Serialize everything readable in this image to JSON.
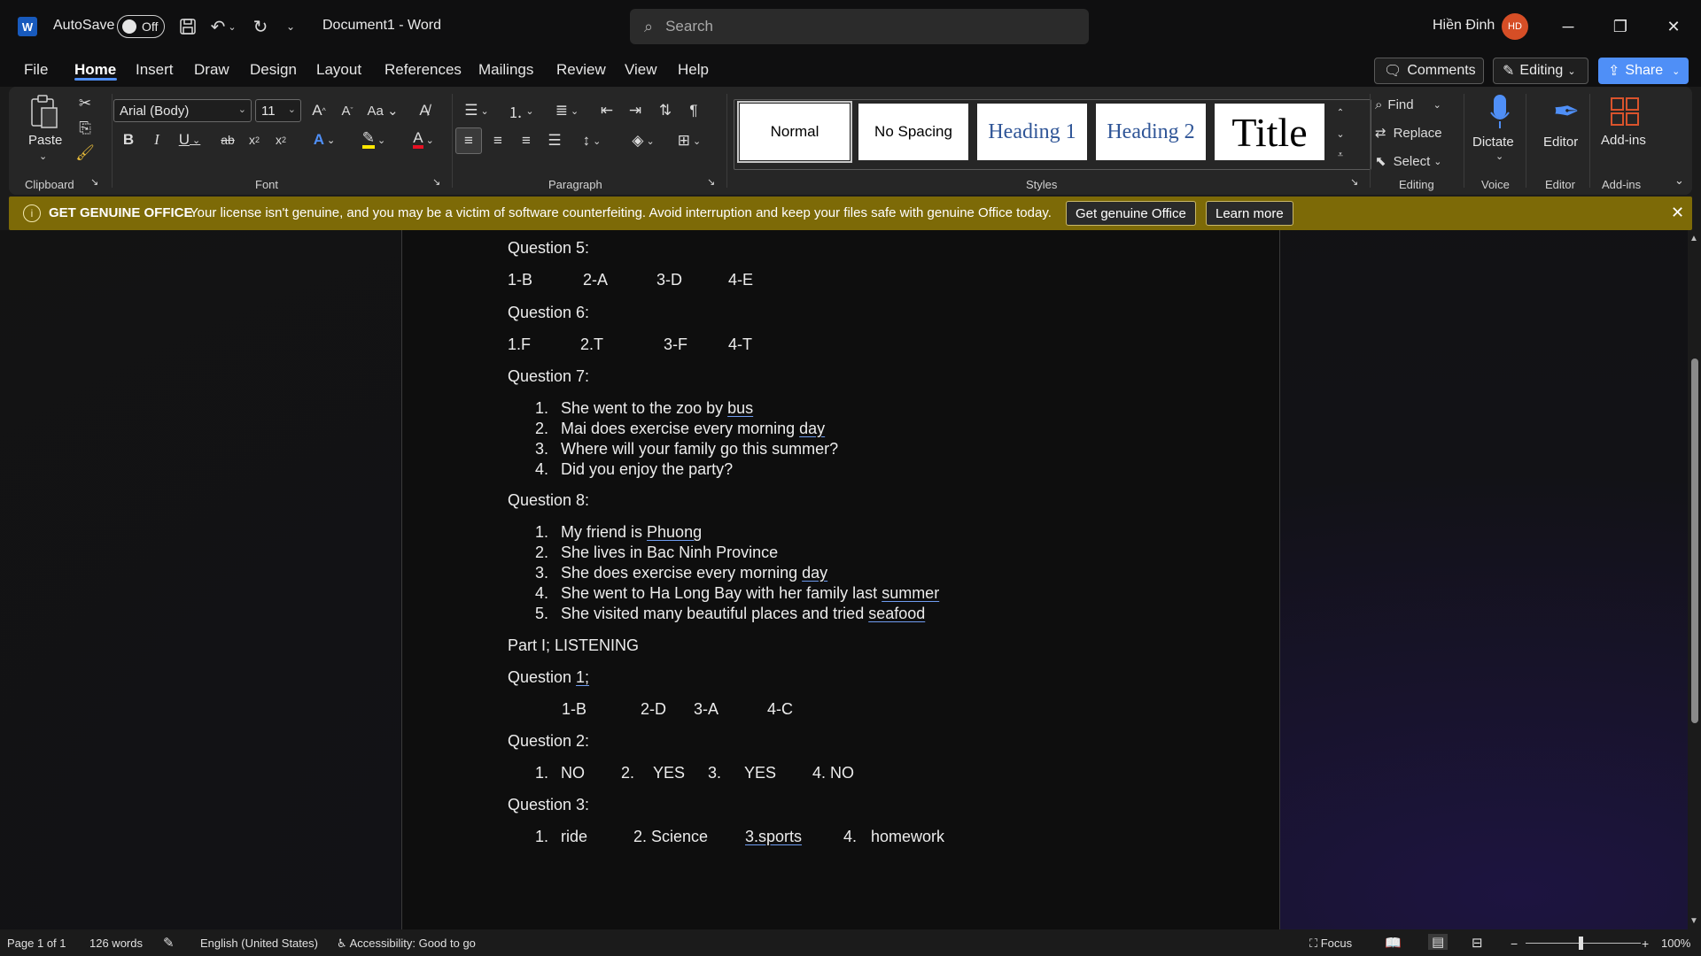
{
  "titlebar": {
    "app_icon": "word-icon",
    "autosave_label": "AutoSave",
    "autosave_state": "Off",
    "doc_title": "Document1  -  Word",
    "search_placeholder": "Search",
    "user_name": "Hiền Đinh",
    "user_initials": "HD"
  },
  "menu": {
    "tabs": [
      "File",
      "Home",
      "Insert",
      "Draw",
      "Design",
      "Layout",
      "References",
      "Mailings",
      "Review",
      "View",
      "Help"
    ],
    "active_tab": "Home",
    "comments_label": "Comments",
    "editing_label": "Editing",
    "share_label": "Share"
  },
  "ribbon": {
    "clipboard": {
      "paste_label": "Paste",
      "group_label": "Clipboard"
    },
    "font": {
      "font_name": "Arial (Body)",
      "font_size": "11",
      "group_label": "Font"
    },
    "paragraph": {
      "group_label": "Paragraph"
    },
    "styles": {
      "group_label": "Styles",
      "items": [
        "Normal",
        "No Spacing",
        "Heading 1",
        "Heading 2",
        "Title"
      ]
    },
    "editing": {
      "find_label": "Find",
      "replace_label": "Replace",
      "select_label": "Select",
      "group_label": "Editing"
    },
    "voice": {
      "dictate_label": "Dictate",
      "group_label": "Voice"
    },
    "editor": {
      "editor_label": "Editor",
      "group_label": "Editor"
    },
    "addins": {
      "addins_label": "Add-ins",
      "group_label": "Add-ins"
    },
    "colors": {
      "highlight": "#ffe600",
      "font_color": "#e81123",
      "accent": "#4f8ff7"
    }
  },
  "infobar": {
    "label": "GET GENUINE OFFICE",
    "message": "Your license isn't genuine, and you may be a victim of software counterfeiting. Avoid interruption and keep your files safe with genuine Office today.",
    "primary_button": "Get genuine Office",
    "secondary_button": "Learn more",
    "background": "#7d6a07"
  },
  "document": {
    "q5_heading": "Question 5:",
    "q5_answers": [
      "1-B",
      "2-A",
      "3-D",
      "4-E"
    ],
    "q6_heading": "Question 6:",
    "q6_answers": [
      "1.F",
      "2.T",
      "3-F",
      "4-T"
    ],
    "q7_heading": "Question 7:",
    "q7_items": [
      {
        "num": "1.",
        "text": "She went to the zoo by ",
        "ul": "bus"
      },
      {
        "num": "2.",
        "text": "Mai does exercise every morning ",
        "ul": "day"
      },
      {
        "num": "3.",
        "text": "Where will your family go this summer?",
        "ul": ""
      },
      {
        "num": "4.",
        "text": "Did you enjoy the party?",
        "ul": ""
      }
    ],
    "q8_heading": "Question 8:",
    "q8_items": [
      {
        "num": "1.",
        "text": "My friend is ",
        "ul": "Phuong"
      },
      {
        "num": "2.",
        "text": "She lives in Bac Ninh Province",
        "ul": ""
      },
      {
        "num": "3.",
        "text": "She does exercise every morning ",
        "ul": "day"
      },
      {
        "num": "4.",
        "text": "She went to Ha Long Bay with her family last ",
        "ul": "summer"
      },
      {
        "num": "5.",
        "text": "She visited many beautiful places and tried ",
        "ul": "seafood"
      }
    ],
    "part1_heading": "Part I; LISTENING",
    "l_q1_prefix": "Question ",
    "l_q1_ul": "1;",
    "l_q1_answers": [
      "1-B",
      "2-D",
      "3-A",
      "4-C"
    ],
    "l_q2_heading": "Question 2:",
    "l_q2_answers": [
      "1.",
      "NO",
      "2.",
      "YES",
      "3.",
      "YES",
      "4. NO"
    ],
    "l_q3_heading": "Question 3:",
    "l_q3_answers": [
      "1.",
      "ride",
      "2. Science",
      "3.sports",
      "4.",
      "homework"
    ]
  },
  "statusbar": {
    "page": "Page 1 of 1",
    "words": "126 words",
    "language": "English (United States)",
    "accessibility": "Accessibility: Good to go",
    "focus_label": "Focus",
    "zoom": "100%"
  }
}
